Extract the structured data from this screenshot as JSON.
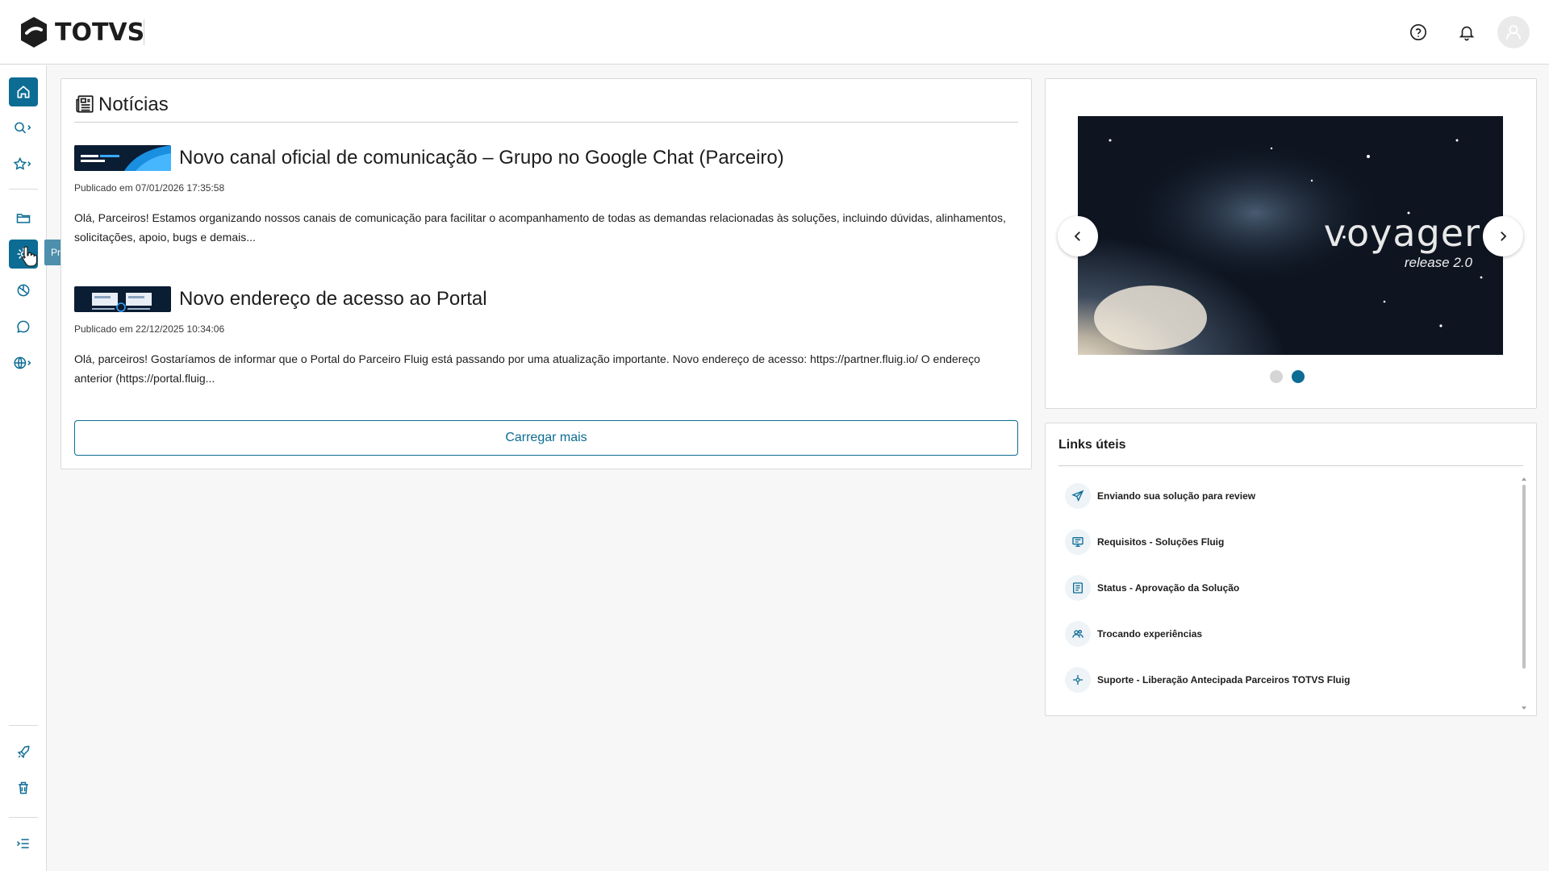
{
  "header": {
    "brand": "TOTVS",
    "help_icon": "help-circle-icon",
    "bell_icon": "bell-icon",
    "avatar_icon": "user-avatar-icon"
  },
  "sidebar": {
    "items": [
      {
        "name": "home",
        "icon": "home-icon",
        "active": true
      },
      {
        "name": "search",
        "icon": "search-icon"
      },
      {
        "name": "favorites",
        "icon": "star-icon"
      },
      {
        "name": "documents",
        "icon": "folder-icon"
      },
      {
        "name": "processes",
        "icon": "processes-icon"
      },
      {
        "name": "analytics",
        "icon": "pie-chart-icon"
      },
      {
        "name": "messages",
        "icon": "chat-icon"
      },
      {
        "name": "network",
        "icon": "globe-icon"
      },
      {
        "name": "launch",
        "icon": "rocket-icon"
      },
      {
        "name": "trash",
        "icon": "trash-icon"
      },
      {
        "name": "collapse",
        "icon": "collapse-menu-icon"
      }
    ],
    "tooltip": "Processos"
  },
  "news": {
    "title": "Notícias",
    "articles": [
      {
        "title": "Novo canal oficial de comunicação – Grupo no Google Chat (Parceiro)",
        "date": "Publicado em 07/01/2026 17:35:58",
        "body": "Olá, Parceiros! Estamos organizando nossos canais de comunicação para facilitar o acompanhamento de todas as demandas relacionadas às soluções, incluindo dúvidas, alinhamentos, solicitações, apoio, bugs e demais...",
        "thumb_text": "Novo canal oficial de comunicação"
      },
      {
        "title": "Novo endereço de acesso ao Portal",
        "date": "Publicado em 22/12/2025 10:34:06",
        "body": "Olá, parceiros! Gostaríamos de informar que o Portal do Parceiro Fluig está passando por uma atualização importante. Novo endereço de acesso: https://partner.fluig.io/ O endereço anterior (https://portal.fluig...",
        "thumb_text": "portal.fluig.io"
      }
    ],
    "load_more": "Carregar mais"
  },
  "carousel": {
    "slide_title": "voyager",
    "slide_subtitle": "release 2.0",
    "active_index": 1,
    "slide_count": 2
  },
  "links": {
    "title": "Links úteis",
    "items": [
      {
        "label": "Enviando sua solução para review",
        "icon": "send-icon"
      },
      {
        "label": "Requisitos - Soluções Fluig",
        "icon": "monitor-icon"
      },
      {
        "label": "Status - Aprovação da Solução",
        "icon": "checklist-icon"
      },
      {
        "label": "Trocando experiências",
        "icon": "users-icon"
      },
      {
        "label": "Suporte - Liberação Antecipada Parceiros TOTVS Fluig",
        "icon": "support-icon"
      }
    ]
  },
  "colors": {
    "primary": "#0c6c94",
    "tooltip_bg": "#4d8fac",
    "text": "#1d1d1d",
    "border": "#dadada"
  }
}
